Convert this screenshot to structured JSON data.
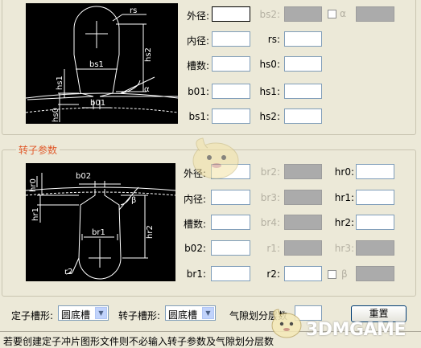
{
  "stator": {
    "diagram_labels": {
      "rs": "rs",
      "bs1": "bs1",
      "hs1": "hs1",
      "hs2": "hs2",
      "hs0": "hs0",
      "b01": "b01",
      "alpha": "α"
    },
    "fields": [
      {
        "label": "外径:",
        "value": "",
        "disabled": false
      },
      {
        "label": "内径:",
        "value": "",
        "disabled": false
      },
      {
        "label": "槽数:",
        "value": "",
        "disabled": false
      },
      {
        "label": "b01:",
        "value": "",
        "disabled": false
      },
      {
        "label": "bs1:",
        "value": "",
        "disabled": false
      },
      {
        "label": "bs2:",
        "value": "",
        "disabled": true
      },
      {
        "label": "rs:",
        "value": "",
        "disabled": false
      },
      {
        "label": "hs0:",
        "value": "",
        "disabled": false
      },
      {
        "label": "hs1:",
        "value": "",
        "disabled": false
      },
      {
        "label": "hs2:",
        "value": "",
        "disabled": false
      }
    ],
    "alpha": {
      "label": "α",
      "checked": false,
      "value": "",
      "disabled": true
    }
  },
  "rotor": {
    "title": "转子参数",
    "diagram_labels": {
      "b02": "b02",
      "hr0": "hr0",
      "hr1": "hr1",
      "hr2": "hr2",
      "br1": "br1",
      "r2": "r2",
      "beta": "β"
    },
    "fields": [
      {
        "label": "外径:",
        "value": "",
        "disabled": false
      },
      {
        "label": "内径:",
        "value": "",
        "disabled": false
      },
      {
        "label": "槽数:",
        "value": "",
        "disabled": false
      },
      {
        "label": "b02:",
        "value": "",
        "disabled": false
      },
      {
        "label": "br1:",
        "value": "",
        "disabled": false
      },
      {
        "label": "br2:",
        "value": "",
        "disabled": true
      },
      {
        "label": "br3:",
        "value": "",
        "disabled": true
      },
      {
        "label": "br4:",
        "value": "",
        "disabled": true
      },
      {
        "label": "r1:",
        "value": "",
        "disabled": true
      },
      {
        "label": "r2:",
        "value": "",
        "disabled": false
      },
      {
        "label": "hr0:",
        "value": "",
        "disabled": false
      },
      {
        "label": "hr1:",
        "value": "",
        "disabled": false
      },
      {
        "label": "hr2:",
        "value": "",
        "disabled": false
      },
      {
        "label": "hr3:",
        "value": "",
        "disabled": true
      }
    ],
    "beta": {
      "label": "β",
      "checked": false,
      "value": "",
      "disabled": true
    }
  },
  "bottom": {
    "stator_slot_label": "定子槽形:",
    "stator_slot_value": "圆底槽",
    "rotor_slot_label": "转子槽形:",
    "rotor_slot_value": "圆底槽",
    "airgap_label": "气隙划分层数",
    "airgap_value": "",
    "reset_label": "重置"
  },
  "status_text": "若要创建定子冲片图形文件则不必输入转子参数及气隙划分层数",
  "watermark": "3DMGAME",
  "icons": [
    "chevron-down-icon",
    "mascot-watermark-icon"
  ],
  "colors": {
    "group_title": "#e0592a",
    "window_bg": "#ece9d8",
    "disabled_field": "#ababab",
    "diagram_bg": "#000000"
  }
}
